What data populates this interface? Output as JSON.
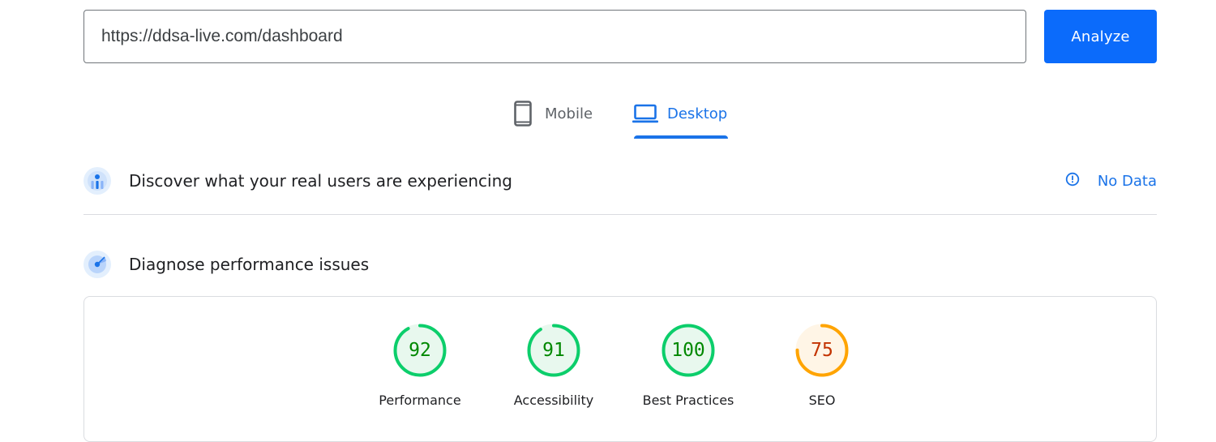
{
  "url_bar": {
    "value": "https://ddsa-live.com/dashboard",
    "analyze_label": "Analyze"
  },
  "tabs": [
    {
      "label": "Mobile",
      "icon": "smartphone-icon",
      "active": false
    },
    {
      "label": "Desktop",
      "icon": "laptop-icon",
      "active": true
    }
  ],
  "crux": {
    "title": "Discover what your real users are experiencing",
    "icon": "users-chart-icon",
    "status_label": "No Data",
    "status_icon": "info-icon"
  },
  "diagnose": {
    "title": "Diagnose performance issues",
    "icon": "target-icon"
  },
  "scores": [
    {
      "label": "Performance",
      "value": 92,
      "rating": "pass"
    },
    {
      "label": "Accessibility",
      "value": 91,
      "rating": "pass"
    },
    {
      "label": "Best Practices",
      "value": 100,
      "rating": "pass"
    },
    {
      "label": "SEO",
      "value": 75,
      "rating": "average"
    }
  ],
  "colors": {
    "accent": "#1a73e8",
    "button": "#0b6bfb",
    "pass_stroke": "#0cce6b",
    "pass_fill": "#e8f8ee",
    "pass_text": "#008800",
    "average_stroke": "#ffa400",
    "average_fill": "#fff5e6",
    "average_text": "#c33300"
  }
}
